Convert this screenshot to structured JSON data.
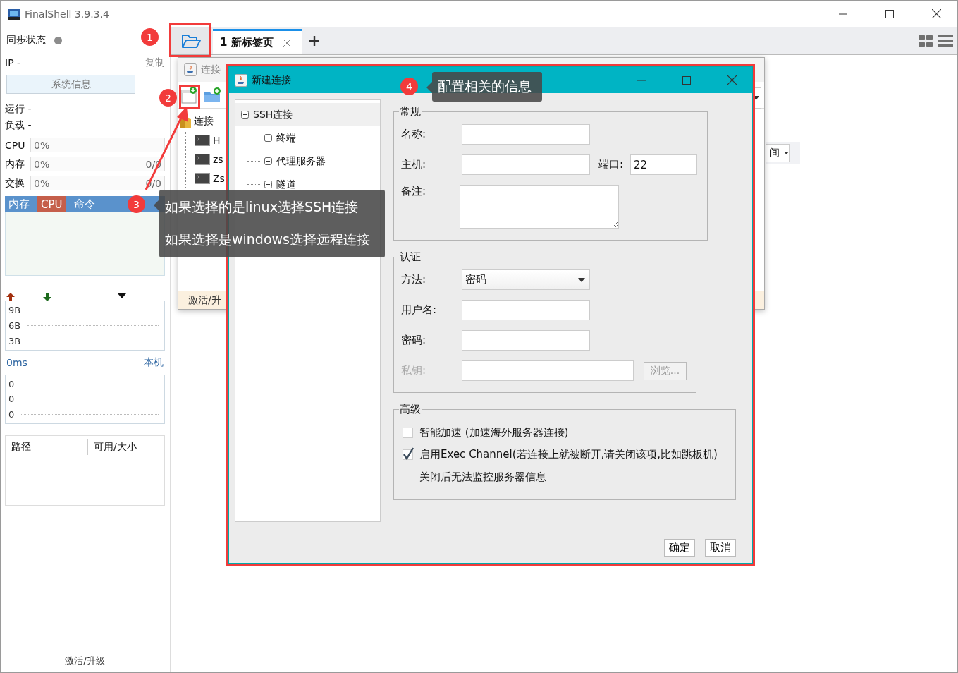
{
  "window": {
    "title": "FinalShell 3.9.3.4"
  },
  "sidebar": {
    "sync_status": "同步状态",
    "ip": "IP  -",
    "copy_link": "复制",
    "sysinfo_button": "系统信息",
    "uptime": "运行 -",
    "load": "负载 -",
    "meters": [
      {
        "label": "CPU",
        "reading": "0%"
      },
      {
        "label": "内存",
        "reading": "0%",
        "usage": "0/0"
      },
      {
        "label": "交换",
        "reading": "0%",
        "usage": "0/0"
      }
    ],
    "process_tabs": [
      {
        "label": "内存",
        "selected": false
      },
      {
        "label": "CPU",
        "selected": true
      },
      {
        "label": "命令",
        "selected": false
      }
    ],
    "traffic_ticks": [
      "9B",
      "6B",
      "3B"
    ],
    "latency": "0ms",
    "latency_host": "本机",
    "latency_ticks": [
      "0",
      "0",
      "0"
    ],
    "disk_table": {
      "columns": [
        "路径",
        "可用/大小"
      ]
    },
    "footer_link": "激活/升级"
  },
  "tabs": [
    {
      "label": "1 新标签页",
      "selected": true
    }
  ],
  "view_dropdown": "间",
  "connection_manager": {
    "title": "连接",
    "tree": {
      "label": "连接",
      "children": [
        {
          "label": "H"
        },
        {
          "label": "zs"
        },
        {
          "label": "Zs"
        }
      ]
    },
    "footer_link": "激活/升"
  },
  "dialog": {
    "title": "新建连接",
    "tree": [
      {
        "label": "SSH连接",
        "selected": true,
        "children": [
          {
            "label": "终端",
            "selected": false
          },
          {
            "label": "代理服务器",
            "selected": false
          },
          {
            "label": "隧道",
            "selected": false
          }
        ]
      }
    ],
    "general": {
      "title": "常规",
      "name_label": "名称:",
      "host_label": "主机:",
      "port_label": "端口:",
      "port": "22",
      "note_label": "备注:"
    },
    "auth": {
      "title": "认证",
      "method_label": "方法:",
      "method": "密码",
      "username_label": "用户名:",
      "password_label": "密码:",
      "key_label": "私钥:",
      "key_disabled": true,
      "browse_button": "浏览..."
    },
    "advanced": {
      "title": "高级",
      "options": [
        {
          "label": "智能加速 (加速海外服务器连接)",
          "checked": false
        },
        {
          "label": "启用Exec Channel(若连接上就被断开,请关闭该项,比如跳板机)",
          "checked": true
        }
      ],
      "note": "关闭后无法监控服务器信息"
    },
    "buttons": [
      "确定",
      "取消"
    ]
  },
  "annotations": [
    {
      "number": "1"
    },
    {
      "number": "2"
    },
    {
      "number": "3",
      "lines": [
        "如果选择的是linux选择SSH连接",
        "如果选择是windows选择远程连接"
      ]
    },
    {
      "number": "4",
      "lines": [
        "配置相关的信息"
      ]
    }
  ]
}
